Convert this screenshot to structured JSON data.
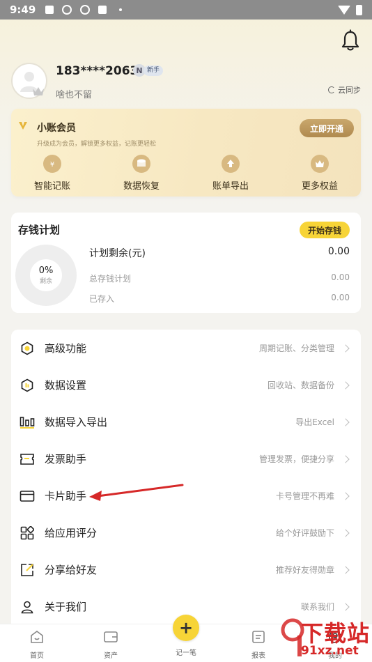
{
  "status_bar": {
    "time": "9:49"
  },
  "profile": {
    "phone": "183****2063",
    "badge_letter": "N",
    "badge_text": "新手",
    "motto": "啥也不留",
    "sync_label": "云同步"
  },
  "vip": {
    "title": "小账会员",
    "subtitle": "升级成为会员，解锁更多权益，记账更轻松",
    "button": "立即开通",
    "features": [
      {
        "label": "智能记账",
        "icon": "yen-cloud-icon"
      },
      {
        "label": "数据恢复",
        "icon": "database-icon"
      },
      {
        "label": "账单导出",
        "icon": "upload-cloud-icon"
      },
      {
        "label": "更多权益",
        "icon": "crown-icon"
      }
    ],
    "accent": "#b08a4f"
  },
  "savings": {
    "title": "存钱计划",
    "button": "开始存钱",
    "progress_text": "0%",
    "progress_label": "剩余",
    "progress": 0,
    "rows": [
      {
        "label": "计划剩余(元)",
        "value": "0.00"
      },
      {
        "label": "总存钱计划",
        "value": "0.00"
      },
      {
        "label": "已存入",
        "value": "0.00"
      }
    ]
  },
  "menu": [
    {
      "label": "高级功能",
      "desc": "周期记账、分类管理",
      "icon": "hexagon-icon"
    },
    {
      "label": "数据设置",
      "desc": "回收站、数据备份",
      "icon": "data-shield-icon"
    },
    {
      "label": "数据导入导出",
      "desc": "导出Excel",
      "icon": "bar-chart-icon"
    },
    {
      "label": "发票助手",
      "desc": "管理发票，便捷分享",
      "icon": "invoice-icon"
    },
    {
      "label": "卡片助手",
      "desc": "卡号管理不再难",
      "icon": "card-icon"
    },
    {
      "label": "给应用评分",
      "desc": "给个好评鼓励下",
      "icon": "grid-icon"
    },
    {
      "label": "分享给好友",
      "desc": "推荐好友得勋章",
      "icon": "share-icon"
    },
    {
      "label": "关于我们",
      "desc": "联系我们",
      "icon": "user-icon"
    }
  ],
  "tabs": [
    {
      "label": "首页",
      "icon": "home-icon"
    },
    {
      "label": "资产",
      "icon": "wallet-icon"
    },
    {
      "label": "记一笔",
      "icon": "plus-icon"
    },
    {
      "label": "报表",
      "icon": "report-icon"
    },
    {
      "label": "我的",
      "icon": "profile-icon"
    }
  ],
  "watermark": {
    "line1": "下载站",
    "line2": "91xz.net"
  },
  "colors": {
    "yellow": "#f7d437",
    "annotation_arrow": "#d62828"
  }
}
